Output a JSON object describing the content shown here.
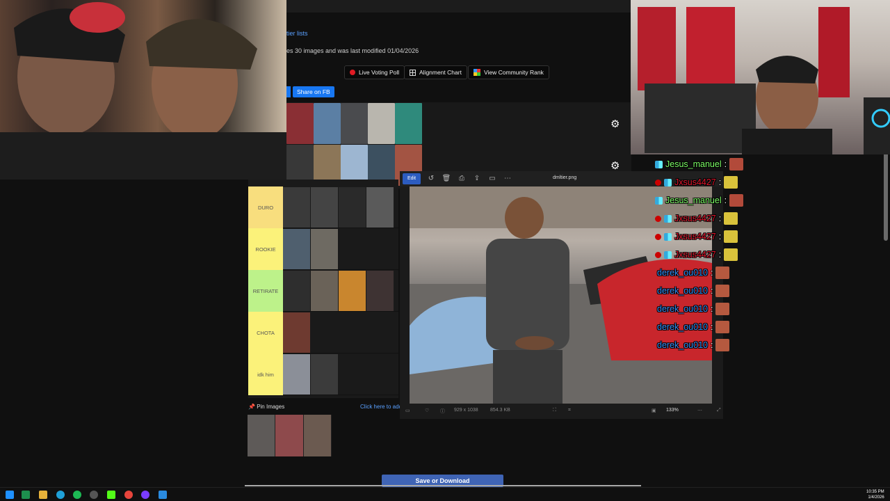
{
  "page": {
    "tier_lists_link": "tier lists",
    "info_text": "es 30 images and was last modified 01/04/2026",
    "buttons": {
      "live_voting": "Live Voting Poll",
      "alignment": "Alignment Chart",
      "community": "View Community Rank",
      "share_fb": "Share on FB"
    },
    "tiers": [
      {
        "label": "DURO",
        "color": "#f8de7e"
      },
      {
        "label": "ROOKIE",
        "color": "#fbf27a"
      },
      {
        "label": "RETIRATE",
        "color": "#bdf28a"
      },
      {
        "label": "CHOTA",
        "color": "#fbf27a"
      },
      {
        "label": "idk him",
        "color": "#fbf27a"
      }
    ],
    "pin_images": "Pin Images",
    "click_add": "Click here to add",
    "save_button": "Save or Download"
  },
  "viewer": {
    "edit_label": "Edit",
    "filename": "dmltier.png",
    "dimensions": "929 x 1038",
    "filesize": "854.3 KB",
    "zoom": "133%"
  },
  "chat": {
    "messages": [
      {
        "user": "Jesus_manuel",
        "color": "#7cfc66",
        "emote": "#b24a3a",
        "live": false
      },
      {
        "user": "Jxsus4427",
        "color": "#e0152b",
        "emote": "#d9c23b",
        "live": true
      },
      {
        "user": "Jesus_manuel",
        "color": "#7cfc66",
        "emote": "#b24a3a",
        "live": false
      },
      {
        "user": "Jxsus4427",
        "color": "#e0152b",
        "emote": "#d9c23b",
        "live": true
      },
      {
        "user": "Jxsus4427",
        "color": "#e0152b",
        "emote": "#d9c23b",
        "live": true
      },
      {
        "user": "Jxsus4427",
        "color": "#e0152b",
        "emote": "#d9c23b",
        "live": true
      },
      {
        "user": "derek_ou010",
        "color": "#2f8cf2",
        "emote": "#b5593f",
        "live": false
      },
      {
        "user": "derek_ou010",
        "color": "#2f8cf2",
        "emote": "#b5593f",
        "live": false
      },
      {
        "user": "derek_ou010",
        "color": "#2f8cf2",
        "emote": "#b5593f",
        "live": false
      },
      {
        "user": "derek_ou010",
        "color": "#2f8cf2",
        "emote": "#b5593f",
        "live": false
      },
      {
        "user": "derek_ou010",
        "color": "#2f8cf2",
        "emote": "#b5593f",
        "live": false
      }
    ]
  },
  "taskbar": {
    "time": "10:35 PM",
    "date": "1/4/2026"
  }
}
